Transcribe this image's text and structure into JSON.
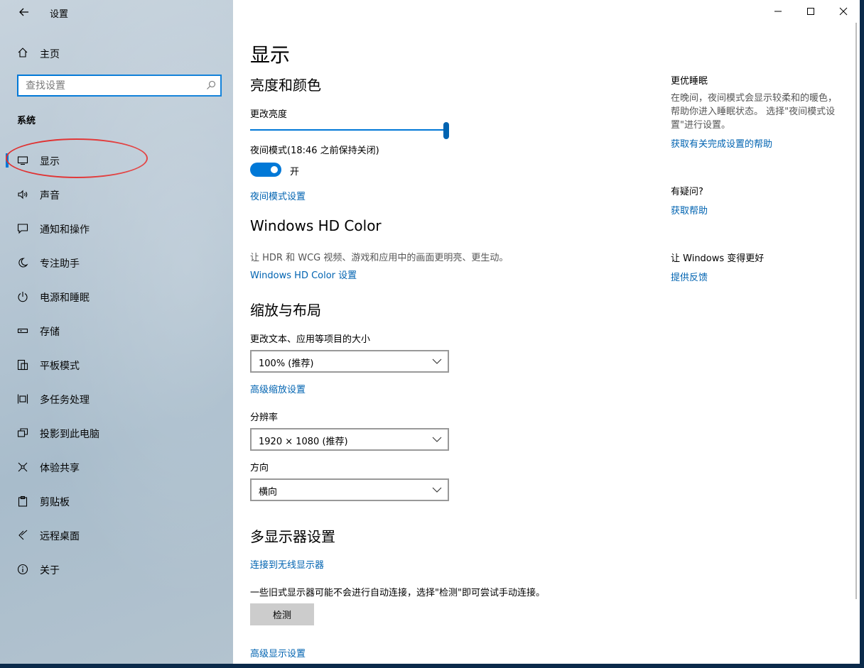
{
  "window": {
    "title": "设置"
  },
  "sidebar": {
    "home_label": "主页",
    "search_placeholder": "查找设置",
    "section_label": "系统",
    "items": [
      {
        "label": "显示",
        "icon": "monitor-icon",
        "active": true
      },
      {
        "label": "声音",
        "icon": "speaker-icon"
      },
      {
        "label": "通知和操作",
        "icon": "message-icon"
      },
      {
        "label": "专注助手",
        "icon": "moon-icon"
      },
      {
        "label": "电源和睡眠",
        "icon": "power-icon"
      },
      {
        "label": "存储",
        "icon": "storage-icon"
      },
      {
        "label": "平板模式",
        "icon": "tablet-icon"
      },
      {
        "label": "多任务处理",
        "icon": "multitask-icon"
      },
      {
        "label": "投影到此电脑",
        "icon": "project-icon"
      },
      {
        "label": "体验共享",
        "icon": "share-icon"
      },
      {
        "label": "剪贴板",
        "icon": "clipboard-icon"
      },
      {
        "label": "远程桌面",
        "icon": "remote-icon"
      },
      {
        "label": "关于",
        "icon": "info-icon"
      }
    ]
  },
  "main": {
    "page_title": "显示",
    "brightness": {
      "heading": "亮度和颜色",
      "change_brightness_label": "更改亮度",
      "brightness_value": 1.0,
      "night_mode_label": "夜间模式(18:46 之前保持关闭)",
      "night_mode_state": "开",
      "night_mode_on": true,
      "night_mode_link": "夜间模式设置"
    },
    "hdr": {
      "heading": "Windows HD Color",
      "description": "让 HDR 和 WCG 视频、游戏和应用中的画面更明亮、更生动。",
      "link": "Windows HD Color 设置"
    },
    "scale": {
      "heading": "缩放与布局",
      "size_label": "更改文本、应用等项目的大小",
      "size_value": "100% (推荐)",
      "advanced_link": "高级缩放设置",
      "resolution_label": "分辨率",
      "resolution_value": "1920 × 1080 (推荐)",
      "orientation_label": "方向",
      "orientation_value": "横向"
    },
    "multi": {
      "heading": "多显示器设置",
      "wireless_link": "连接到无线显示器",
      "note": "一些旧式显示器可能不会进行自动连接，选择\"检测\"即可尝试手动连接。",
      "detect_button": "检测",
      "advanced_display_link": "高级显示设置"
    }
  },
  "aside": {
    "sleep_heading": "更优睡眠",
    "sleep_text": "在晚间，夜间模式会显示较柔和的暖色，帮助你进入睡眠状态。 选择\"夜间模式设置\"进行设置。",
    "sleep_link": "获取有关完成设置的帮助",
    "question_heading": "有疑问?",
    "help_link": "获取帮助",
    "improve_heading": "让 Windows 变得更好",
    "feedback_link": "提供反馈"
  },
  "colors": {
    "accent": "#0078d7",
    "link": "#0063b1",
    "annotation": "#e03030"
  }
}
